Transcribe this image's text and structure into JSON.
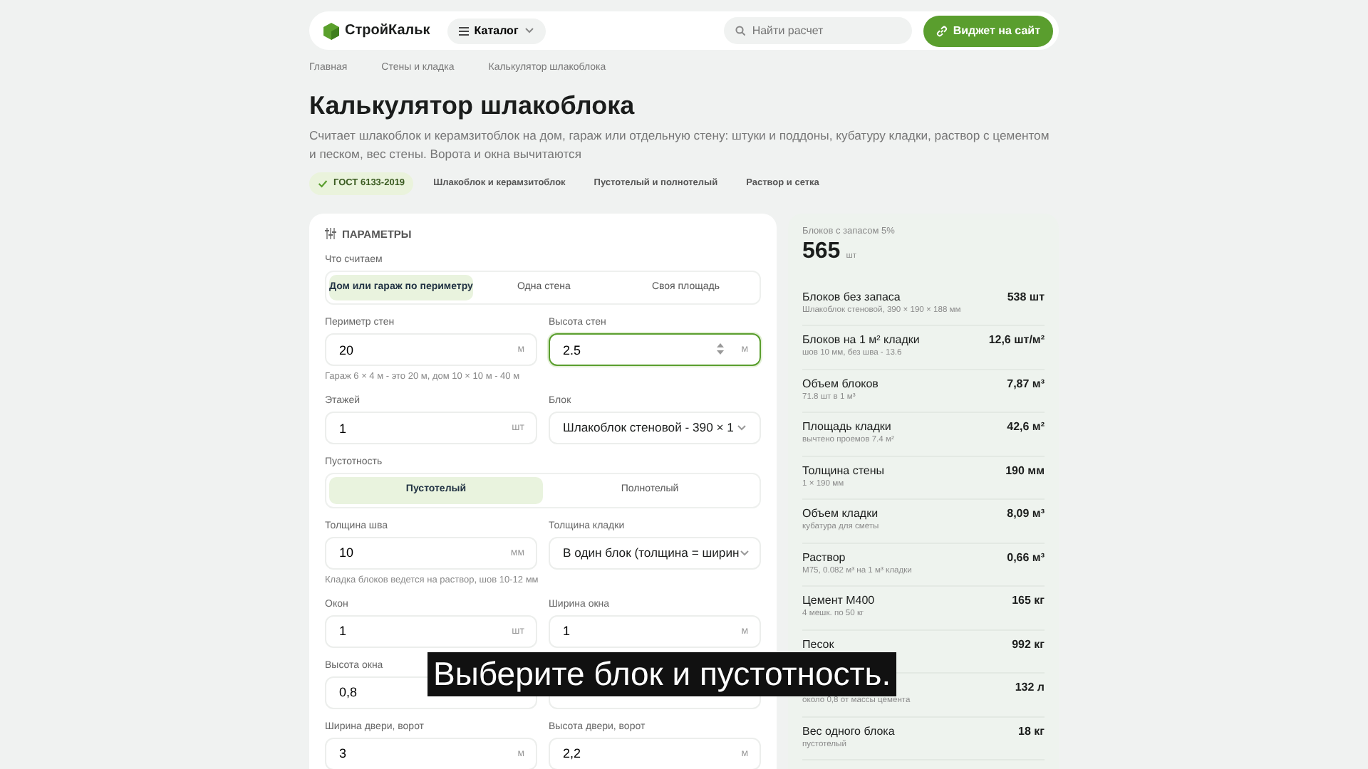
{
  "header": {
    "logo": "СтройКальк",
    "catalog": "Каталог",
    "search": {
      "placeholder": "Найти расчет"
    },
    "widget_button": "Виджет на сайт"
  },
  "breadcrumbs": [
    "Главная",
    "Стены и кладка",
    "Калькулятор шлакоблока"
  ],
  "title": "Калькулятор шлакоблока",
  "description": "Считает шлакоблок и керамзитоблок на дом, гараж или отдельную стену: штуки и поддоны, кубатуру кладки, раствор с цементом и песком, вес стены. Ворота и окна вычитаются",
  "tags": [
    {
      "label": "ГОСТ 6133-2019",
      "checked": true
    },
    {
      "label": "Шлакоблок и керамзитоблок",
      "checked": false
    },
    {
      "label": "Пустотелый и полнотелый",
      "checked": false
    },
    {
      "label": "Раствор и сетка",
      "checked": false
    }
  ],
  "form": {
    "title": "ПАРАМЕТРЫ",
    "rows": [
      {
        "kind": "segmented",
        "label": "Что считаем",
        "options": [
          {
            "label": "Дом или гараж по периметру",
            "selected": true
          },
          {
            "label": "Одна стена",
            "selected": false
          },
          {
            "label": "Своя площадь",
            "selected": false
          }
        ]
      },
      {
        "kind": "fields",
        "fields": [
          {
            "kind": "input",
            "label": "Периметр стен",
            "value": "20",
            "unit": "м",
            "focused": false
          },
          {
            "kind": "input",
            "label": "Высота стен",
            "value": "2.5",
            "unit": "м",
            "focused": true
          }
        ]
      },
      {
        "kind": "hint",
        "text": "Гараж 6 × 4 м - это 20 м, дом 10 × 10 м - 40 м"
      },
      {
        "kind": "fields",
        "fields": [
          {
            "kind": "input",
            "label": "Этажей",
            "value": "1",
            "unit": "шт",
            "focused": false
          },
          {
            "kind": "select",
            "label": "Блок",
            "value": "Шлакоблок стеновой - 390 × 1"
          }
        ]
      },
      {
        "kind": "segmented",
        "label": "Пустотность",
        "options": [
          {
            "label": "Пустотелый",
            "selected": true
          },
          {
            "label": "Полнотелый",
            "selected": false
          }
        ]
      },
      {
        "kind": "fields",
        "fields": [
          {
            "kind": "input",
            "label": "Толщина шва",
            "value": "10",
            "unit": "мм",
            "focused": false
          },
          {
            "kind": "select",
            "label": "Толщина кладки",
            "value": "В один блок (толщина = ширин"
          }
        ]
      },
      {
        "kind": "hint",
        "text": "Кладка блоков ведется на раствор, шов 10-12 мм"
      },
      {
        "kind": "fields",
        "fields": [
          {
            "kind": "input",
            "label": "Окон",
            "value": "1",
            "unit": "шт",
            "focused": false
          },
          {
            "kind": "input",
            "label": "Ширина окна",
            "value": "1",
            "unit": "м",
            "focused": false
          }
        ]
      },
      {
        "kind": "fields",
        "fields": [
          {
            "kind": "input",
            "label": "Высота окна",
            "value": "0,8",
            "focused": false
          },
          {
            "kind": "input"
          }
        ]
      },
      {
        "kind": "fields",
        "fields": [
          {
            "kind": "input",
            "label": "Ширина двери, ворот",
            "value": "3",
            "unit": "м",
            "focused": false
          },
          {
            "kind": "input",
            "label": "Высота двери, ворот",
            "value": "2,2",
            "unit": "м",
            "focused": false
          }
        ]
      }
    ]
  },
  "results": {
    "total_label": "Блоков с запасом 5%",
    "total_value": "565",
    "total_unit": "шт",
    "rows": [
      {
        "label": "Блоков без запаса",
        "sub": "Шлакоблок стеновой, 390 × 190 × 188 мм",
        "value": "538 шт"
      },
      {
        "label": "Блоков на 1 м² кладки",
        "sub": "шов 10 мм, без шва - 13.6",
        "value": "12,6 шт/м²"
      },
      {
        "label": "Объем блоков",
        "sub": "71.8 шт в 1 м³",
        "value": "7,87 м³"
      },
      {
        "label": "Площадь кладки",
        "sub": "вычтено проемов 7.4 м²",
        "value": "42,6 м²"
      },
      {
        "label": "Толщина стены",
        "sub": "1 × 190 мм",
        "value": "190 мм"
      },
      {
        "label": "Объем кладки",
        "sub": "кубатура для сметы",
        "value": "8,09 м³"
      },
      {
        "label": "Раствор",
        "sub": "М75, 0.082 м³ на 1 м³ кладки",
        "value": "0,66 м³"
      },
      {
        "label": "Цемент М400",
        "sub": "4 мешк. по 50 кг",
        "value": "165 кг"
      },
      {
        "label": "Песок",
        "value": "992 кг"
      },
      {
        "sub": "около 0,8 от массы цемента",
        "value": "132 л"
      },
      {
        "label": "Вес одного блока",
        "sub": "пустотелый",
        "value": "18 кг"
      }
    ]
  },
  "caption": "Выберите блок и пустотность."
}
